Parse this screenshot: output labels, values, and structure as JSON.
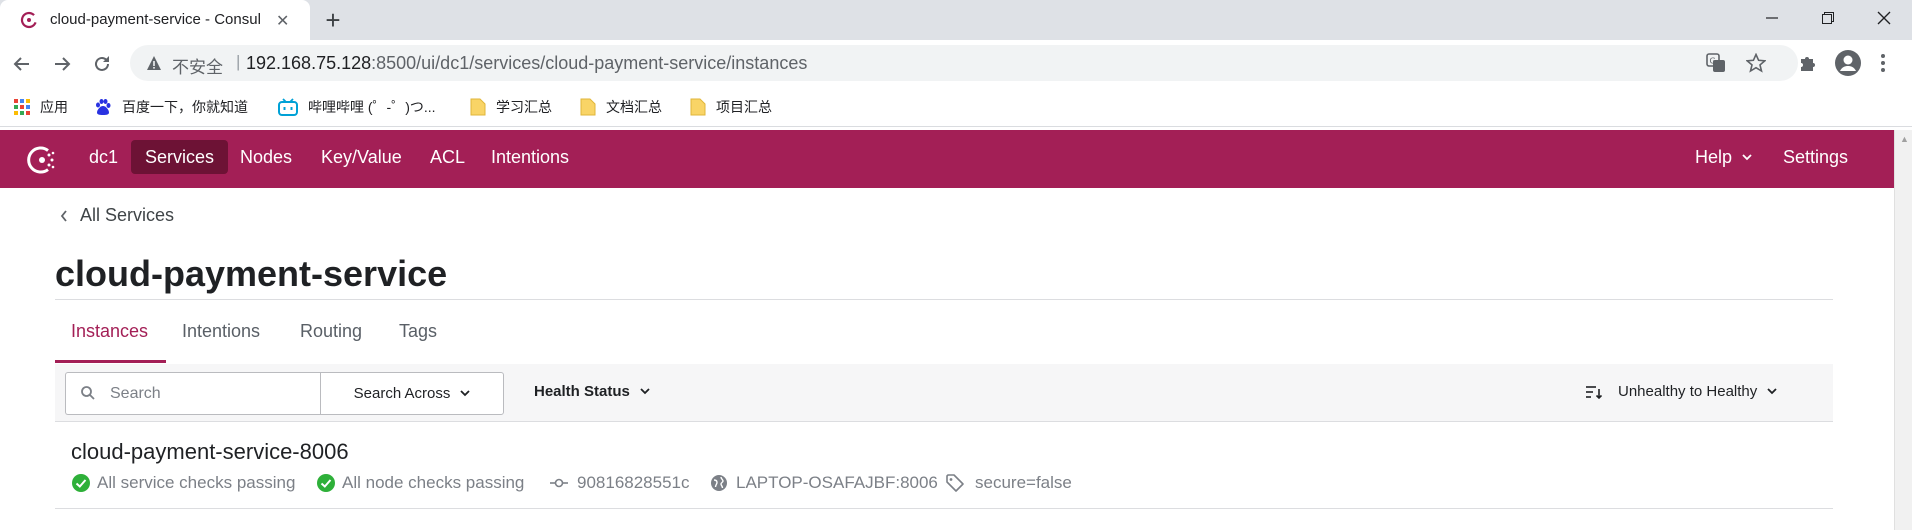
{
  "browser": {
    "tab_title": "cloud-payment-service - Consul",
    "security_label": "不安全",
    "url_host": "192.168.75.128",
    "url_rest": ":8500/ui/dc1/services/cloud-payment-service/instances"
  },
  "bookmarks": [
    {
      "label": "应用",
      "icon": "apps-grid-icon"
    },
    {
      "label": "百度一下，你就知道",
      "icon": "baidu-paw-icon"
    },
    {
      "label": "哔哩哔哩 (゜-゜)つ...",
      "icon": "bilibili-tv-icon"
    },
    {
      "label": "学习汇总",
      "icon": "folder-icon"
    },
    {
      "label": "文档汇总",
      "icon": "folder-icon"
    },
    {
      "label": "项目汇总",
      "icon": "folder-icon"
    }
  ],
  "nav": {
    "datacenter": "dc1",
    "items": [
      "Services",
      "Nodes",
      "Key/Value",
      "ACL",
      "Intentions"
    ],
    "active": "Services",
    "help": "Help",
    "settings": "Settings"
  },
  "breadcrumb": "All Services",
  "page_title": "cloud-payment-service",
  "tabs": [
    "Instances",
    "Intentions",
    "Routing",
    "Tags"
  ],
  "active_tab": "Instances",
  "filters": {
    "search_placeholder": "Search",
    "search_across": "Search Across",
    "health_status": "Health Status",
    "sort": "Unhealthy to Healthy"
  },
  "instance": {
    "name": "cloud-payment-service-8006",
    "service_checks": "All service checks passing",
    "node_checks": "All node checks passing",
    "node_id": "90816828551c",
    "address": "LAPTOP-OSAFAJBF:8006",
    "tag": "secure=false"
  },
  "colors": {
    "brand": "#a31f56",
    "brand_active": "#6d1235",
    "passing": "#2eb039"
  }
}
